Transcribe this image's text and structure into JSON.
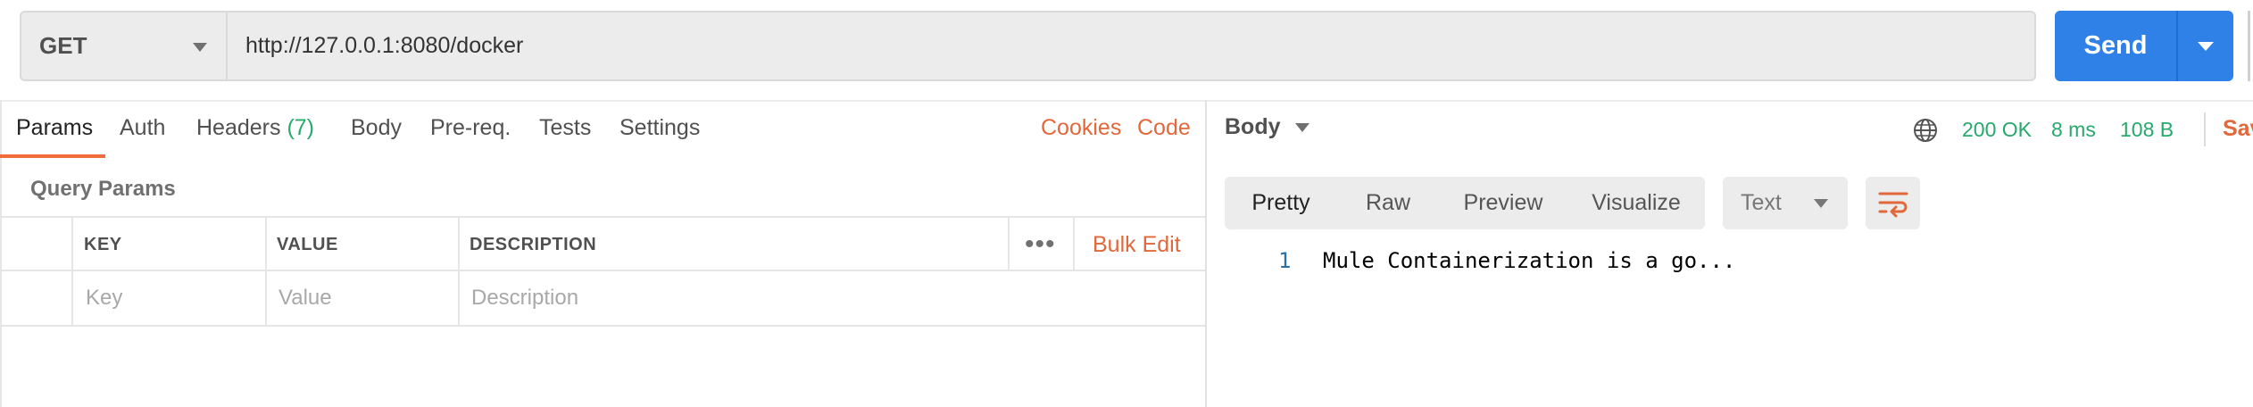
{
  "request": {
    "method": "GET",
    "url": "http://127.0.0.1:8080/docker",
    "send_label": "Send"
  },
  "request_tabs": {
    "params": "Params",
    "auth": "Auth",
    "headers": "Headers",
    "headers_count": "(7)",
    "body": "Body",
    "prereq": "Pre-req.",
    "tests": "Tests",
    "settings": "Settings",
    "cookies": "Cookies",
    "code": "Code"
  },
  "query_params": {
    "title": "Query Params",
    "columns": {
      "key": "KEY",
      "value": "VALUE",
      "description": "DESCRIPTION"
    },
    "more_label": "•••",
    "bulk_edit": "Bulk Edit",
    "placeholders": {
      "key": "Key",
      "value": "Value",
      "description": "Description"
    }
  },
  "response": {
    "body_dropdown": "Body",
    "status": "200 OK",
    "time": "8 ms",
    "size": "108 B",
    "save": "Save",
    "view_tabs": [
      "Pretty",
      "Raw",
      "Preview",
      "Visualize"
    ],
    "active_view": "Pretty",
    "format": "Text",
    "lines": [
      {
        "number": "1",
        "text": "Mule Containerization is a go..."
      }
    ]
  },
  "colors": {
    "accent": "#e0683a",
    "send": "#2f80e7",
    "success": "#26a96b"
  },
  "icons": {
    "method_dropdown": "caret-down-icon",
    "send_dropdown": "caret-down-icon",
    "network": "globe-icon",
    "wrap": "wrap-lines-icon"
  }
}
